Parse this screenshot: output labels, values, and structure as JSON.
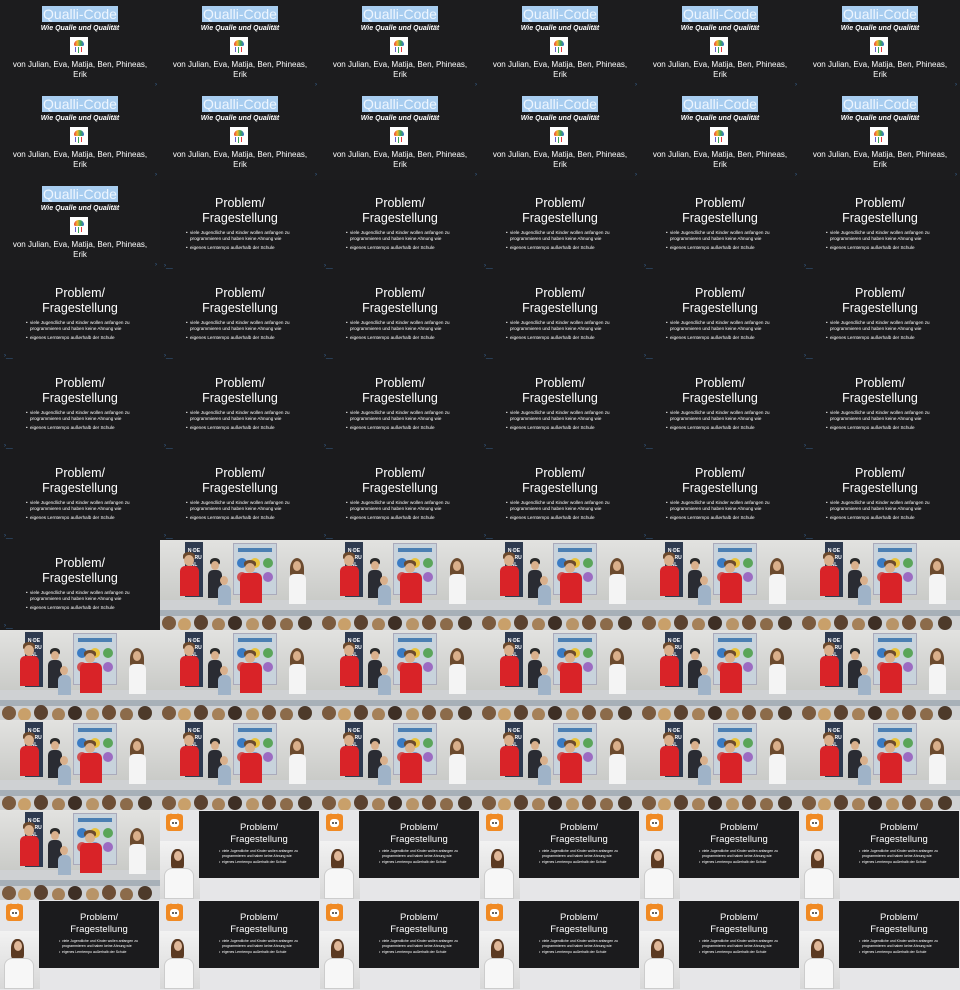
{
  "title_slide": {
    "title": "Qualli-Code",
    "subtitle": "Wie Qualle und Qualität",
    "authors": "von Julian, Eva, Matija, Ben, Phineas, Erik"
  },
  "problem_slide": {
    "title_line1": "Problem/",
    "title_line2": "Fragestellung",
    "bullet1": "viele Jugendliche und Kinder wollen anfangen zu programmieren und haben keine Ahnung wie",
    "bullet2": "eigenes Lerntempo außerhalb der Schule"
  },
  "photo": {
    "banner_text": "N·DE FO RU AL"
  },
  "colors": {
    "background": "#1b1b1d",
    "title_highlight": "#a8cdf0",
    "shirt_red": "#d92328",
    "badge_orange": "#f08a24"
  },
  "grid": {
    "columns": 6,
    "rows": 11,
    "frames": [
      "title",
      "title",
      "title",
      "title",
      "title",
      "title",
      "title",
      "title",
      "title",
      "title",
      "title",
      "title",
      "title",
      "problem",
      "problem",
      "problem",
      "problem",
      "problem",
      "problem",
      "problem",
      "problem",
      "problem",
      "problem",
      "problem",
      "problem",
      "problem",
      "problem",
      "problem",
      "problem",
      "problem",
      "problem",
      "problem",
      "problem",
      "problem",
      "problem",
      "problem",
      "problem",
      "photo",
      "photo",
      "photo",
      "photo",
      "photo",
      "photo",
      "photo",
      "photo",
      "photo",
      "photo",
      "photo",
      "photo",
      "photo",
      "photo",
      "photo",
      "photo",
      "photo",
      "photo",
      "call",
      "call",
      "call",
      "call",
      "call",
      "call",
      "call",
      "call",
      "call",
      "call",
      "call"
    ]
  }
}
